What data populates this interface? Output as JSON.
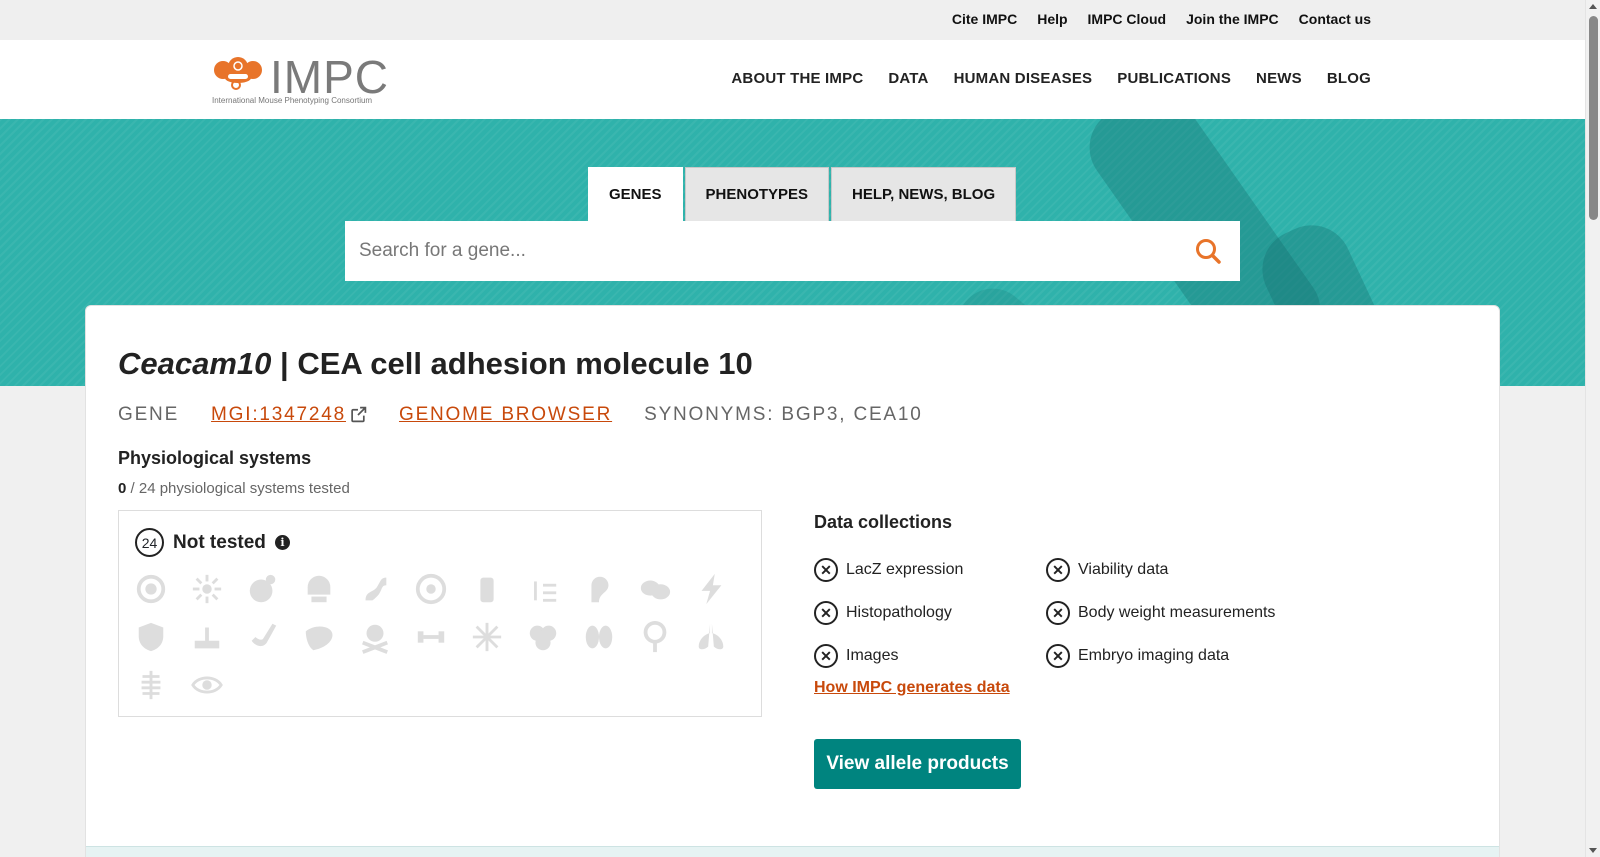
{
  "topbar": {
    "links": [
      "Cite IMPC",
      "Help",
      "IMPC Cloud",
      "Join the IMPC",
      "Contact us"
    ]
  },
  "header": {
    "logo_text": "IMPC",
    "logo_tagline": "International Mouse Phenotyping Consortium",
    "nav": [
      "ABOUT THE IMPC",
      "DATA",
      "HUMAN DISEASES",
      "PUBLICATIONS",
      "NEWS",
      "BLOG"
    ]
  },
  "search": {
    "tabs": [
      "GENES",
      "PHENOTYPES",
      "HELP, NEWS, BLOG"
    ],
    "active_tab": "GENES",
    "placeholder": "Search for a gene..."
  },
  "gene": {
    "symbol": "Ceacam10",
    "separator": " | ",
    "name": "CEA cell adhesion molecule 10",
    "type_label": "GENE",
    "mgi_id": "MGI:1347248",
    "browser_link": "GENOME BROWSER",
    "synonyms": "SYNONYMS: BGP3, CEA10"
  },
  "physiological": {
    "title": "Physiological systems",
    "tested_count": "0",
    "tested_suffix": " / 24 physiological systems tested",
    "not_tested_count": "24",
    "not_tested_label": "Not tested",
    "system_icons": [
      "embryo-icon",
      "immune-icon",
      "growth-icon",
      "craniofacial-icon",
      "digestive-icon",
      "eye-alt-icon",
      "homeostasis-icon",
      "growth-chart-icon",
      "hearing-icon",
      "behaviour-icon",
      "nervous-icon",
      "immunity-icon",
      "integument-icon",
      "limbs-icon",
      "liver-icon",
      "mortality-icon",
      "muscle-icon",
      "pigmentation-icon",
      "hematopoietic-icon",
      "renal-icon",
      "reproductive-icon",
      "respiratory-icon",
      "skeleton-icon",
      "vision-icon"
    ]
  },
  "data_collections": {
    "title": "Data collections",
    "items": [
      "LacZ expression",
      "Viability data",
      "Histopathology",
      "Body weight measurements",
      "Images",
      "Embryo imaging data"
    ],
    "link": "How IMPC generates data"
  },
  "actions": {
    "allele_button": "View allele products"
  },
  "colors": {
    "teal": "#2fb2ab",
    "button_teal": "#00847f",
    "link_orange": "#c8490b",
    "logo_orange": "#e8742a"
  }
}
